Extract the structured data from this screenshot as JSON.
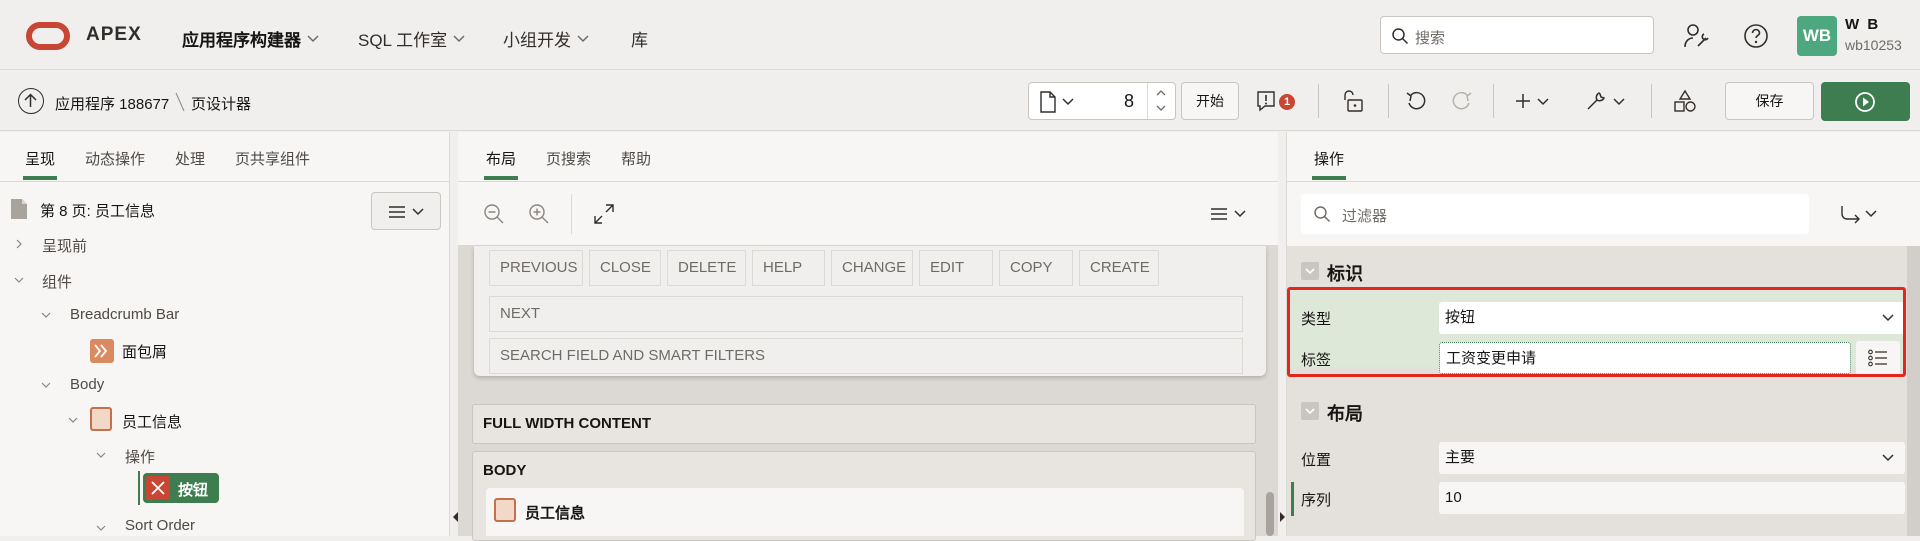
{
  "header": {
    "brand": "APEX",
    "nav": [
      "应用程序构建器",
      "SQL 工作室",
      "小组开发",
      "库"
    ],
    "search_placeholder": "搜索",
    "avatar_initials": "WB",
    "user_name": "W B",
    "user_id": "wb10253"
  },
  "toolbar": {
    "app_label": "应用程序 188677",
    "page_designer_label": "页设计器",
    "page_number": "8",
    "start_label": "开始",
    "issue_count": "1",
    "save_label": "保存"
  },
  "left_panel": {
    "tabs": [
      "呈现",
      "动态操作",
      "处理",
      "页共享组件"
    ],
    "page_title": "第 8 页: 员工信息",
    "tree": {
      "pre_render": "呈现前",
      "components": "组件",
      "breadcrumb_bar": "Breadcrumb Bar",
      "breadcrumb": "面包屑",
      "body": "Body",
      "region": "员工信息",
      "actions": "操作",
      "button": "按钮",
      "sort_order": "Sort Order"
    }
  },
  "middle_panel": {
    "tabs": [
      "布局",
      "页搜索",
      "帮助"
    ],
    "positions_row1": [
      "PREVIOUS",
      "CLOSE",
      "DELETE",
      "HELP",
      "CHANGE",
      "EDIT",
      "COPY",
      "CREATE"
    ],
    "position_next": "NEXT",
    "position_search": "SEARCH FIELD AND SMART FILTERS",
    "full_width": "FULL WIDTH CONTENT",
    "body": "BODY",
    "region_card": "员工信息"
  },
  "right_panel": {
    "tab": "操作",
    "filter_placeholder": "过滤器",
    "identification": {
      "title": "标识",
      "type_label": "类型",
      "type_value": "按钮",
      "label_label": "标签",
      "label_value": "工资变更申请"
    },
    "layout": {
      "title": "布局",
      "position_label": "位置",
      "position_value": "主要",
      "sequence_label": "序列",
      "sequence_value": "10"
    }
  },
  "colors": {
    "accent_green": "#3d7d4f",
    "oracle_red": "#c74634",
    "highlight_red": "#e3271c"
  }
}
